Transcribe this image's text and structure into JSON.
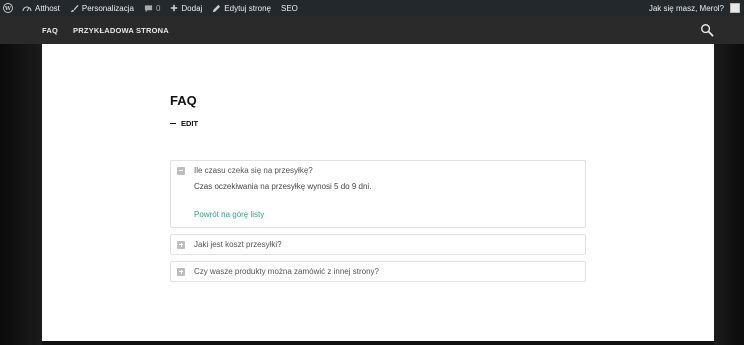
{
  "adminbar": {
    "site_name": "Atthost",
    "customize": "Personalizacja",
    "comments_count": "0",
    "add_new": "Dodaj",
    "edit_page": "Edytuj stronę",
    "seo": "SEO",
    "greeting": "Jak się masz, Merol?"
  },
  "nav": {
    "items": [
      {
        "label": "FAQ"
      },
      {
        "label": "PRZYKŁADOWA STRONA"
      }
    ]
  },
  "page": {
    "title": "FAQ",
    "edit_label": "EDIT"
  },
  "faq": {
    "items": [
      {
        "question": "Ile czasu czeka się na przesyłkę?",
        "answer": "Czas oczekiwania na przesyłkę wynosi 5 do 9 dni.",
        "back_link": "Powrót na górę listy",
        "open": true
      },
      {
        "question": "Jaki jest koszt przesyłki?",
        "open": false
      },
      {
        "question": "Czy wasze produkty można zamówić z innej strony?",
        "open": false
      }
    ]
  },
  "colors": {
    "adminbar_bg": "#23282d",
    "nav_bg": "#2a2a2a",
    "link_green": "#2aa97a"
  }
}
